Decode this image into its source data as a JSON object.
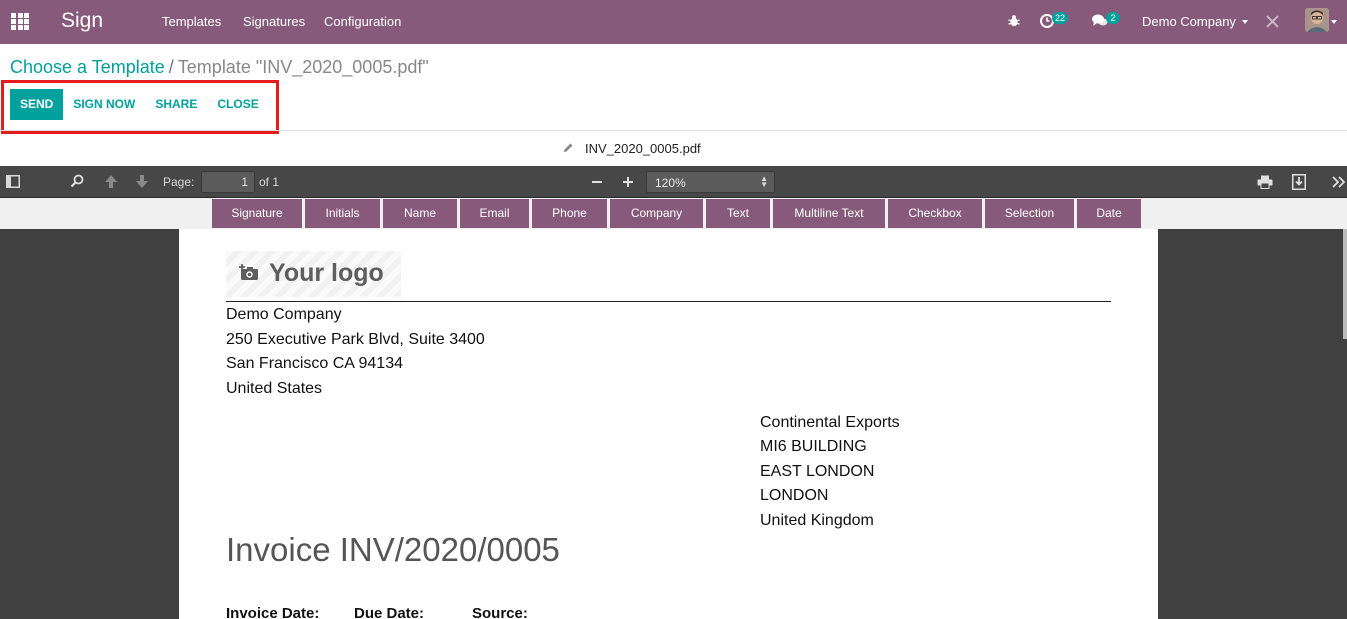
{
  "navbar": {
    "brand": "Sign",
    "menu": [
      "Templates",
      "Signatures",
      "Configuration"
    ],
    "activities_count": "22",
    "messages_count": "2",
    "company": "Demo Company"
  },
  "breadcrumb": {
    "parent": "Choose a Template",
    "current": "Template \"INV_2020_0005.pdf\""
  },
  "buttons": {
    "send": "SEND",
    "sign_now": "SIGN NOW",
    "share": "SHARE",
    "close": "CLOSE"
  },
  "document": {
    "filename": "INV_2020_0005.pdf"
  },
  "pdf_toolbar": {
    "page_label": "Page:",
    "page_value": "1",
    "page_total": "of 1",
    "zoom": "120%"
  },
  "field_types": [
    "Signature",
    "Initials",
    "Name",
    "Email",
    "Phone",
    "Company",
    "Text",
    "Multiline Text",
    "Checkbox",
    "Selection",
    "Date"
  ],
  "invoice": {
    "logo_text": "Your logo",
    "company_address": [
      "Demo Company",
      "250 Executive Park Blvd, Suite 3400",
      "San Francisco CA 94134",
      "United States"
    ],
    "customer_address": [
      "Continental Exports",
      "MI6 BUILDING",
      "EAST LONDON",
      "LONDON",
      "United Kingdom"
    ],
    "title": "Invoice INV/2020/0005",
    "meta_labels": [
      "Invoice Date:",
      "Due Date:",
      "Source:"
    ]
  },
  "colors": {
    "brand": "#875a7b",
    "accent": "#00a09d",
    "highlight": "#e41c1c"
  }
}
